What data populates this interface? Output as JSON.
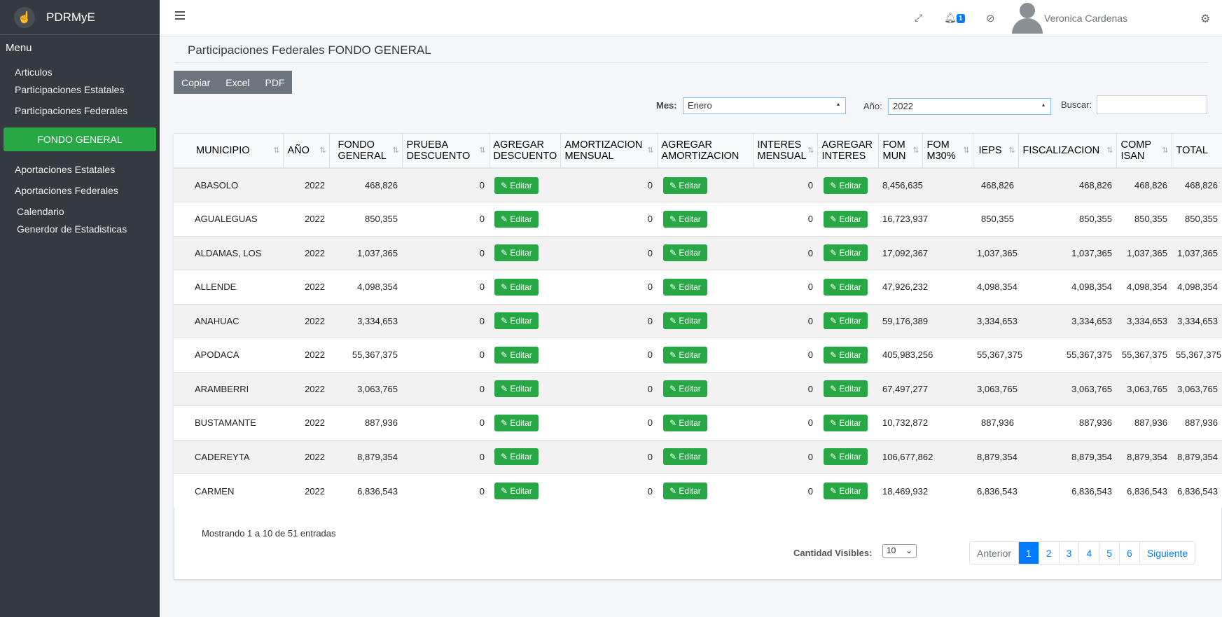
{
  "sidebar": {
    "brand": "PDRMyE",
    "menu_title": "Menu",
    "items": [
      {
        "label": "Articulos"
      },
      {
        "label": "Participaciones Estatales"
      },
      {
        "label": "Participaciones Federales"
      },
      {
        "label": "FONDO GENERAL",
        "active": true
      },
      {
        "label": "Aportaciones Estatales"
      },
      {
        "label": "Aportaciones Federales"
      },
      {
        "label": "Calendario"
      },
      {
        "label": "Generdor de Estadisticas"
      }
    ]
  },
  "topbar": {
    "notification_count": "1",
    "user_name": "Veronica Cardenas"
  },
  "page": {
    "title": "Participaciones Federales FONDO GENERAL",
    "buttons": {
      "copy": "Copiar",
      "excel": "Excel",
      "pdf": "PDF"
    },
    "filters": {
      "month_label": "Mes:",
      "month_value": "Enero",
      "year_label": "Año:",
      "year_value": "2022",
      "search_label": "Buscar:"
    }
  },
  "table": {
    "columns": [
      "MUNICIPIO",
      "AÑO",
      "FONDO GENERAL",
      "PRUEBA DESCUENTO",
      "AGREGAR DESCUENTO",
      "AMORTIZACION MENSUAL",
      "AGREGAR AMORTIZACION",
      "INTERES MENSUAL",
      "AGREGAR INTERES",
      "FOM MUN",
      "FOM M30%",
      "IEPS",
      "FISCALIZACION",
      "COMP ISAN",
      "TOTAL"
    ],
    "edit_label": "Editar",
    "rows": [
      {
        "municipio": "ABASOLO",
        "anio": "2022",
        "fondo": "468,826",
        "prueba": "0",
        "amort": "0",
        "interes": "0",
        "fom_mun": "8,456,635",
        "ieps": "468,826",
        "fisc": "468,826",
        "isan": "468,826",
        "total": "468,826"
      },
      {
        "municipio": "AGUALEGUAS",
        "anio": "2022",
        "fondo": "850,355",
        "prueba": "0",
        "amort": "0",
        "interes": "0",
        "fom_mun": "16,723,937",
        "ieps": "850,355",
        "fisc": "850,355",
        "isan": "850,355",
        "total": "850,355"
      },
      {
        "municipio": "ALDAMAS, LOS",
        "anio": "2022",
        "fondo": "1,037,365",
        "prueba": "0",
        "amort": "0",
        "interes": "0",
        "fom_mun": "17,092,367",
        "ieps": "1,037,365",
        "fisc": "1,037,365",
        "isan": "1,037,365",
        "total": "1,037,365"
      },
      {
        "municipio": "ALLENDE",
        "anio": "2022",
        "fondo": "4,098,354",
        "prueba": "0",
        "amort": "0",
        "interes": "0",
        "fom_mun": "47,926,232",
        "ieps": "4,098,354",
        "fisc": "4,098,354",
        "isan": "4,098,354",
        "total": "4,098,354"
      },
      {
        "municipio": "ANAHUAC",
        "anio": "2022",
        "fondo": "3,334,653",
        "prueba": "0",
        "amort": "0",
        "interes": "0",
        "fom_mun": "59,176,389",
        "ieps": "3,334,653",
        "fisc": "3,334,653",
        "isan": "3,334,653",
        "total": "3,334,653"
      },
      {
        "municipio": "APODACA",
        "anio": "2022",
        "fondo": "55,367,375",
        "prueba": "0",
        "amort": "0",
        "interes": "0",
        "fom_mun": "405,983,256",
        "ieps": "55,367,375",
        "fisc": "55,367,375",
        "isan": "55,367,375",
        "total": "55,367,375"
      },
      {
        "municipio": "ARAMBERRI",
        "anio": "2022",
        "fondo": "3,063,765",
        "prueba": "0",
        "amort": "0",
        "interes": "0",
        "fom_mun": "67,497,277",
        "ieps": "3,063,765",
        "fisc": "3,063,765",
        "isan": "3,063,765",
        "total": "3,063,765"
      },
      {
        "municipio": "BUSTAMANTE",
        "anio": "2022",
        "fondo": "887,936",
        "prueba": "0",
        "amort": "0",
        "interes": "0",
        "fom_mun": "10,732,872",
        "ieps": "887,936",
        "fisc": "887,936",
        "isan": "887,936",
        "total": "887,936"
      },
      {
        "municipio": "CADEREYTA",
        "anio": "2022",
        "fondo": "8,879,354",
        "prueba": "0",
        "amort": "0",
        "interes": "0",
        "fom_mun": "106,677,862",
        "ieps": "8,879,354",
        "fisc": "8,879,354",
        "isan": "8,879,354",
        "total": "8,879,354"
      },
      {
        "municipio": "CARMEN",
        "anio": "2022",
        "fondo": "6,836,543",
        "prueba": "0",
        "amort": "0",
        "interes": "0",
        "fom_mun": "18,469,932",
        "ieps": "6,836,543",
        "fisc": "6,836,543",
        "isan": "6,836,543",
        "total": "6,836,543"
      }
    ]
  },
  "footer": {
    "info": "Mostrando 1 a 10 de 51 entradas",
    "qty_label": "Cantidad Visibles:",
    "qty_value": "10",
    "prev": "Anterior",
    "pages": [
      "1",
      "2",
      "3",
      "4",
      "5",
      "6"
    ],
    "next": "Siguiente"
  }
}
